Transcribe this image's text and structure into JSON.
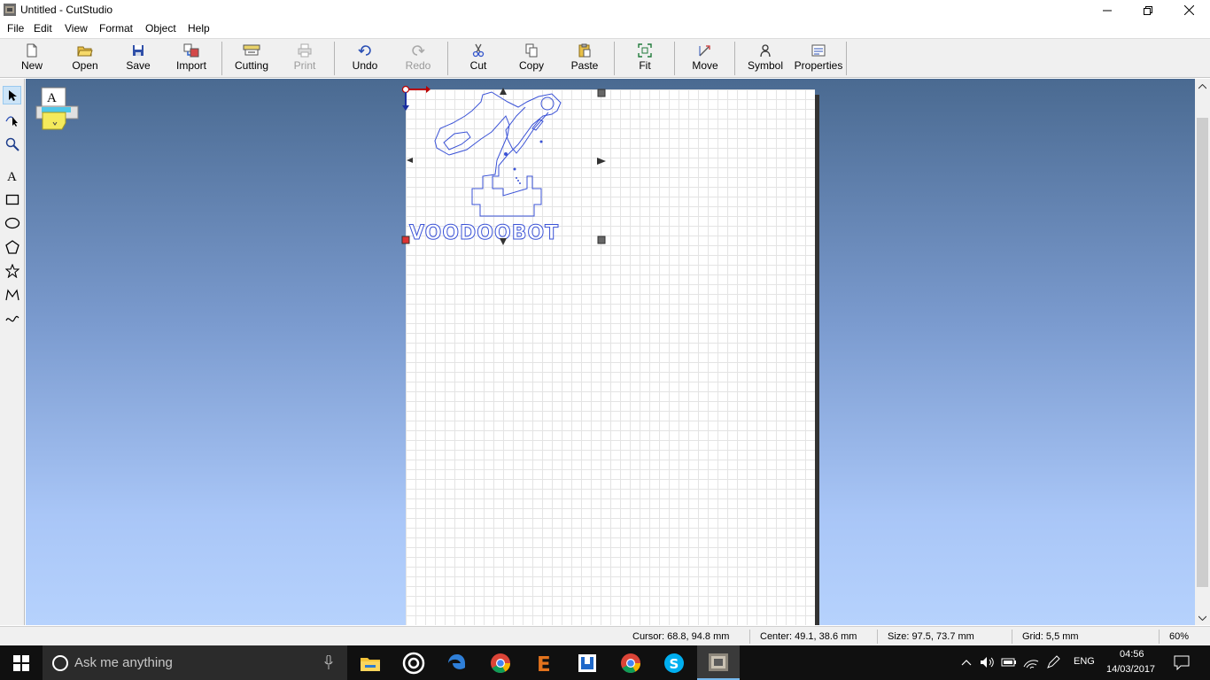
{
  "window": {
    "title": "Untitled - CutStudio"
  },
  "menu": {
    "items": [
      "File",
      "Edit",
      "View",
      "Format",
      "Object",
      "Help"
    ]
  },
  "toolbar": {
    "new": "New",
    "open": "Open",
    "save": "Save",
    "import": "Import",
    "cutting": "Cutting",
    "print": "Print",
    "undo": "Undo",
    "redo": "Redo",
    "cut": "Cut",
    "copy": "Copy",
    "paste": "Paste",
    "fit": "Fit",
    "move": "Move",
    "symbol": "Symbol",
    "properties": "Properties"
  },
  "canvas": {
    "logo_text": "VOODOOBOT",
    "accent": "#3a52d6"
  },
  "status": {
    "cursor": "Cursor: 68.8, 94.8 mm",
    "center": "Center: 49.1, 38.6 mm",
    "size": "Size: 97.5, 73.7 mm",
    "grid": "Grid: 5,5 mm",
    "zoom": "60%"
  },
  "taskbar": {
    "search_placeholder": "Ask me anything",
    "language": "ENG",
    "time": "04:56",
    "date": "14/03/2017"
  }
}
